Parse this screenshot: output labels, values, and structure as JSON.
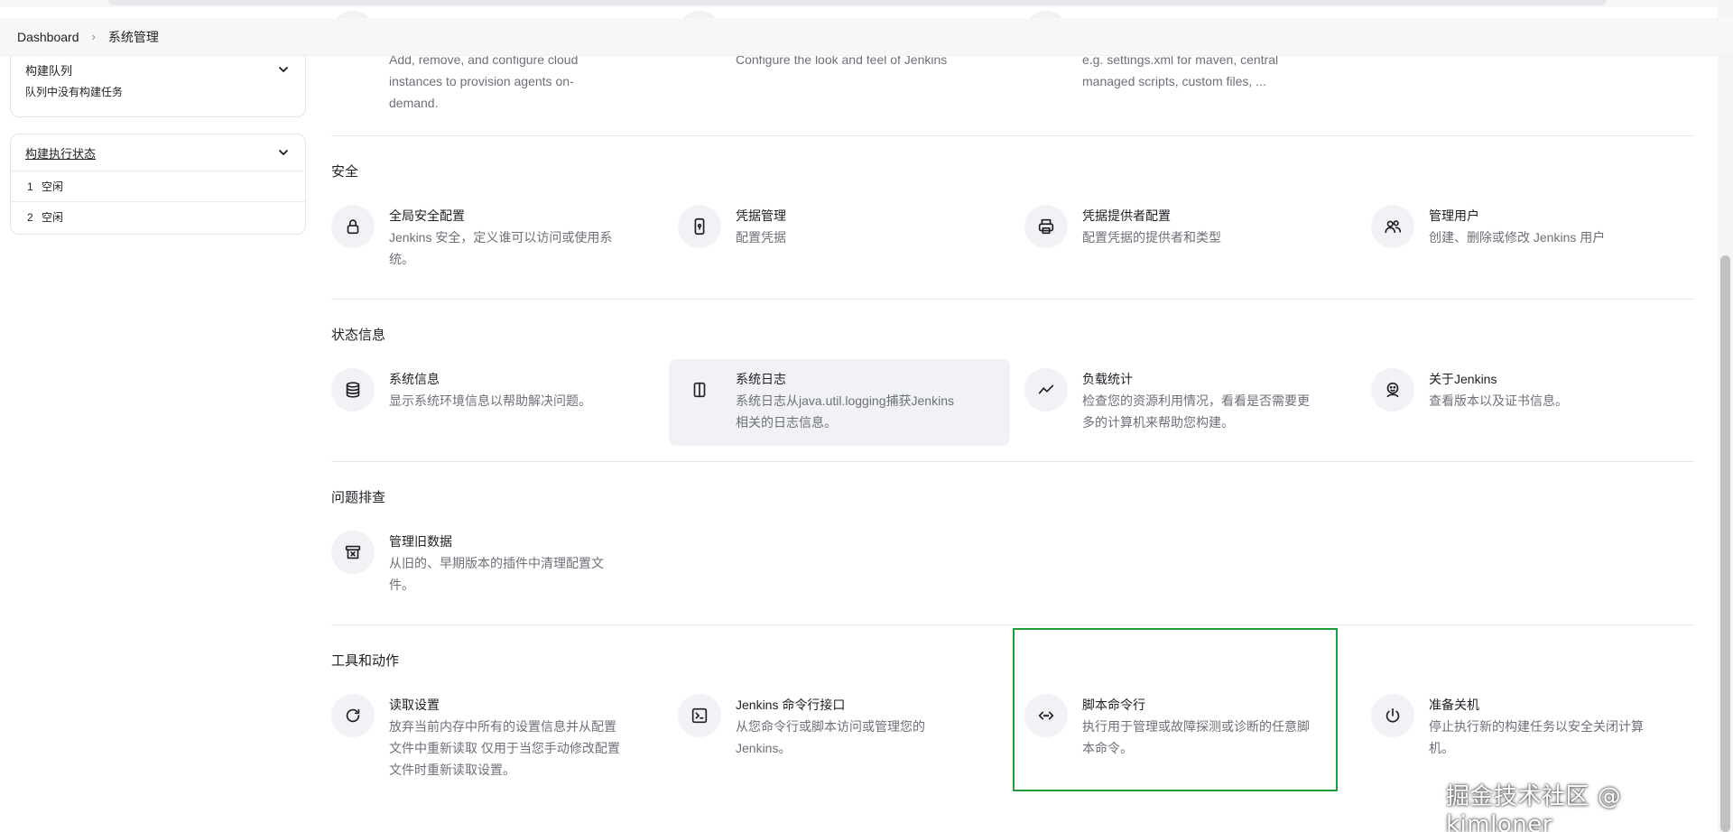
{
  "breadcrumb": {
    "home": "Dashboard",
    "current": "系统管理"
  },
  "sidebar": {
    "queue": {
      "title": "构建队列",
      "empty": "队列中没有构建任务"
    },
    "executors": {
      "title": "构建执行状态",
      "rows": [
        {
          "num": "1",
          "status": "空闲"
        },
        {
          "num": "2",
          "status": "空闲"
        }
      ]
    }
  },
  "top_items": [
    {
      "desc": "Add, remove, and configure cloud instances to provision agents on-demand.",
      "lines": [
        "Add, remove, and configure cloud",
        "instances to provision agents on-",
        "demand."
      ]
    },
    {
      "lines": [
        "Configure the look and feel of Jenkins"
      ]
    },
    {
      "lines": [
        "e.g. settings.xml for maven, central",
        "managed scripts, custom files, ..."
      ]
    }
  ],
  "sections": {
    "security": {
      "title": "安全",
      "items": [
        {
          "title": "全局安全配置",
          "lines": [
            "Jenkins 安全，定义谁可以访问或使用系",
            "统。"
          ],
          "icon": "lock-icon"
        },
        {
          "title": "凭据管理",
          "lines": [
            "配置凭据"
          ],
          "icon": "phone-key-icon"
        },
        {
          "title": "凭据提供者配置",
          "lines": [
            "配置凭据的提供者和类型"
          ],
          "icon": "printer-icon"
        },
        {
          "title": "管理用户",
          "lines": [
            "创建、删除或修改 Jenkins 用户"
          ],
          "icon": "users-icon"
        }
      ]
    },
    "status": {
      "title": "状态信息",
      "items": [
        {
          "title": "系统信息",
          "lines": [
            "显示系统环境信息以帮助解决问题。"
          ],
          "icon": "database-icon"
        },
        {
          "title": "系统日志",
          "lines": [
            "系统日志从java.util.logging捕获Jenkins",
            "相关的日志信息。"
          ],
          "icon": "book-icon"
        },
        {
          "title": "负载统计",
          "lines": [
            "检查您的资源利用情况，看看是否需要更",
            "多的计算机来帮助您构建。"
          ],
          "icon": "trend-icon"
        },
        {
          "title": "关于Jenkins",
          "lines": [
            "查看版本以及证书信息。"
          ],
          "icon": "jenkins-icon"
        }
      ]
    },
    "troubleshoot": {
      "title": "问题排查",
      "items": [
        {
          "title": "管理旧数据",
          "lines": [
            "从旧的、早期版本的插件中清理配置文",
            "件。"
          ],
          "icon": "archive-icon"
        }
      ]
    },
    "tools": {
      "title": "工具和动作",
      "items": [
        {
          "title": "读取设置",
          "lines": [
            "放弃当前内存中所有的设置信息并从配置",
            "文件中重新读取 仅用于当您手动修改配置",
            "文件时重新读取设置。"
          ],
          "icon": "reload-icon"
        },
        {
          "title": "Jenkins 命令行接口",
          "lines": [
            "从您命令行或脚本访问或管理您的",
            "Jenkins。"
          ],
          "icon": "terminal-icon"
        },
        {
          "title": "脚本命令行",
          "lines": [
            "执行用于管理或故障探测或诊断的任意脚",
            "本命令。"
          ],
          "icon": "code-icon"
        },
        {
          "title": "准备关机",
          "lines": [
            "停止执行新的构建任务以安全关闭计算",
            "机。"
          ],
          "icon": "power-icon"
        }
      ]
    }
  },
  "watermark": "掘金技术社区 @ kimloner"
}
